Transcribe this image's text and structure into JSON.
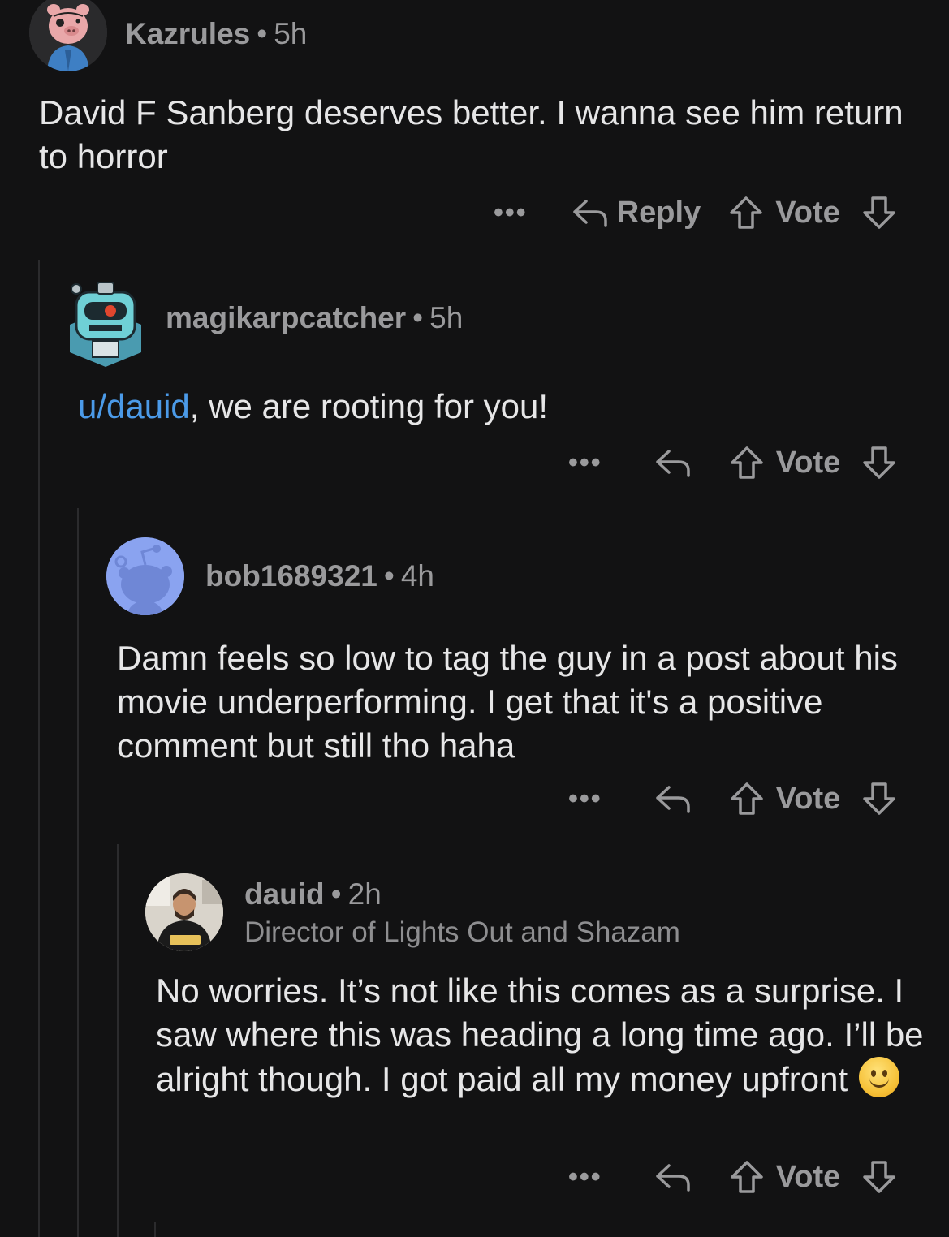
{
  "comments": [
    {
      "username": "Kazrules",
      "time": "5h",
      "body": "David F Sanberg deserves better. I wanna see him return to horror",
      "actions": {
        "more": "•••",
        "reply": "Reply",
        "vote": "Vote"
      }
    },
    {
      "username": "magikarpcatcher",
      "time": "5h",
      "mention": "u/dauid",
      "body_rest": ", we are rooting for you!",
      "actions": {
        "more": "•••",
        "vote": "Vote"
      }
    },
    {
      "username": "bob1689321",
      "time": "4h",
      "body": "Damn feels so low to tag the guy in a post about his movie underperforming. I get that it's a positive comment but still tho haha",
      "actions": {
        "more": "•••",
        "vote": "Vote"
      }
    },
    {
      "username": "dauid",
      "time": "2h",
      "flair": "Director of Lights Out and Shazam",
      "body": "No worries. It’s not like this comes as a surprise. I saw where this was heading a long time ago. I’ll be alright though. I got paid all my money upfront",
      "emoji": "slightly-smiling-face",
      "actions": {
        "more": "•••",
        "vote": "Vote"
      }
    }
  ],
  "separator": "•",
  "colors": {
    "background": "#121213",
    "text": "#e6e6e7",
    "meta": "#9a9a9c",
    "mention": "#4b9ae8",
    "thread_line": "#2b2b2d"
  },
  "icons": [
    "reply-arrow-icon",
    "upvote-arrow-icon",
    "downvote-arrow-icon",
    "more-dots-icon"
  ]
}
